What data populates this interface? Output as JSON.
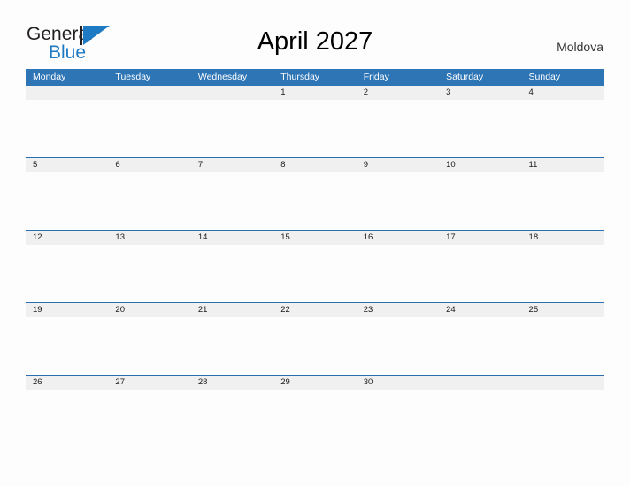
{
  "brand": {
    "name_part1": "General",
    "name_part2": "Blue",
    "flag_icon": "blue-triangle-flag-icon",
    "accent_color": "#1f7ac4",
    "text_color": "#231f20"
  },
  "header": {
    "title": "April 2027",
    "country": "Moldova"
  },
  "calendar": {
    "header_bg_color": "#2e75b6",
    "band_bg_color": "#f0f0f0",
    "rule_color": "#2a6eb0",
    "day_names": [
      "Monday",
      "Tuesday",
      "Wednesday",
      "Thursday",
      "Friday",
      "Saturday",
      "Sunday"
    ],
    "weeks": [
      {
        "dates": [
          "",
          "",
          "",
          "1",
          "2",
          "3",
          "4"
        ]
      },
      {
        "dates": [
          "5",
          "6",
          "7",
          "8",
          "9",
          "10",
          "11"
        ]
      },
      {
        "dates": [
          "12",
          "13",
          "14",
          "15",
          "16",
          "17",
          "18"
        ]
      },
      {
        "dates": [
          "19",
          "20",
          "21",
          "22",
          "23",
          "24",
          "25"
        ]
      },
      {
        "dates": [
          "26",
          "27",
          "28",
          "29",
          "30",
          "",
          ""
        ]
      }
    ]
  }
}
